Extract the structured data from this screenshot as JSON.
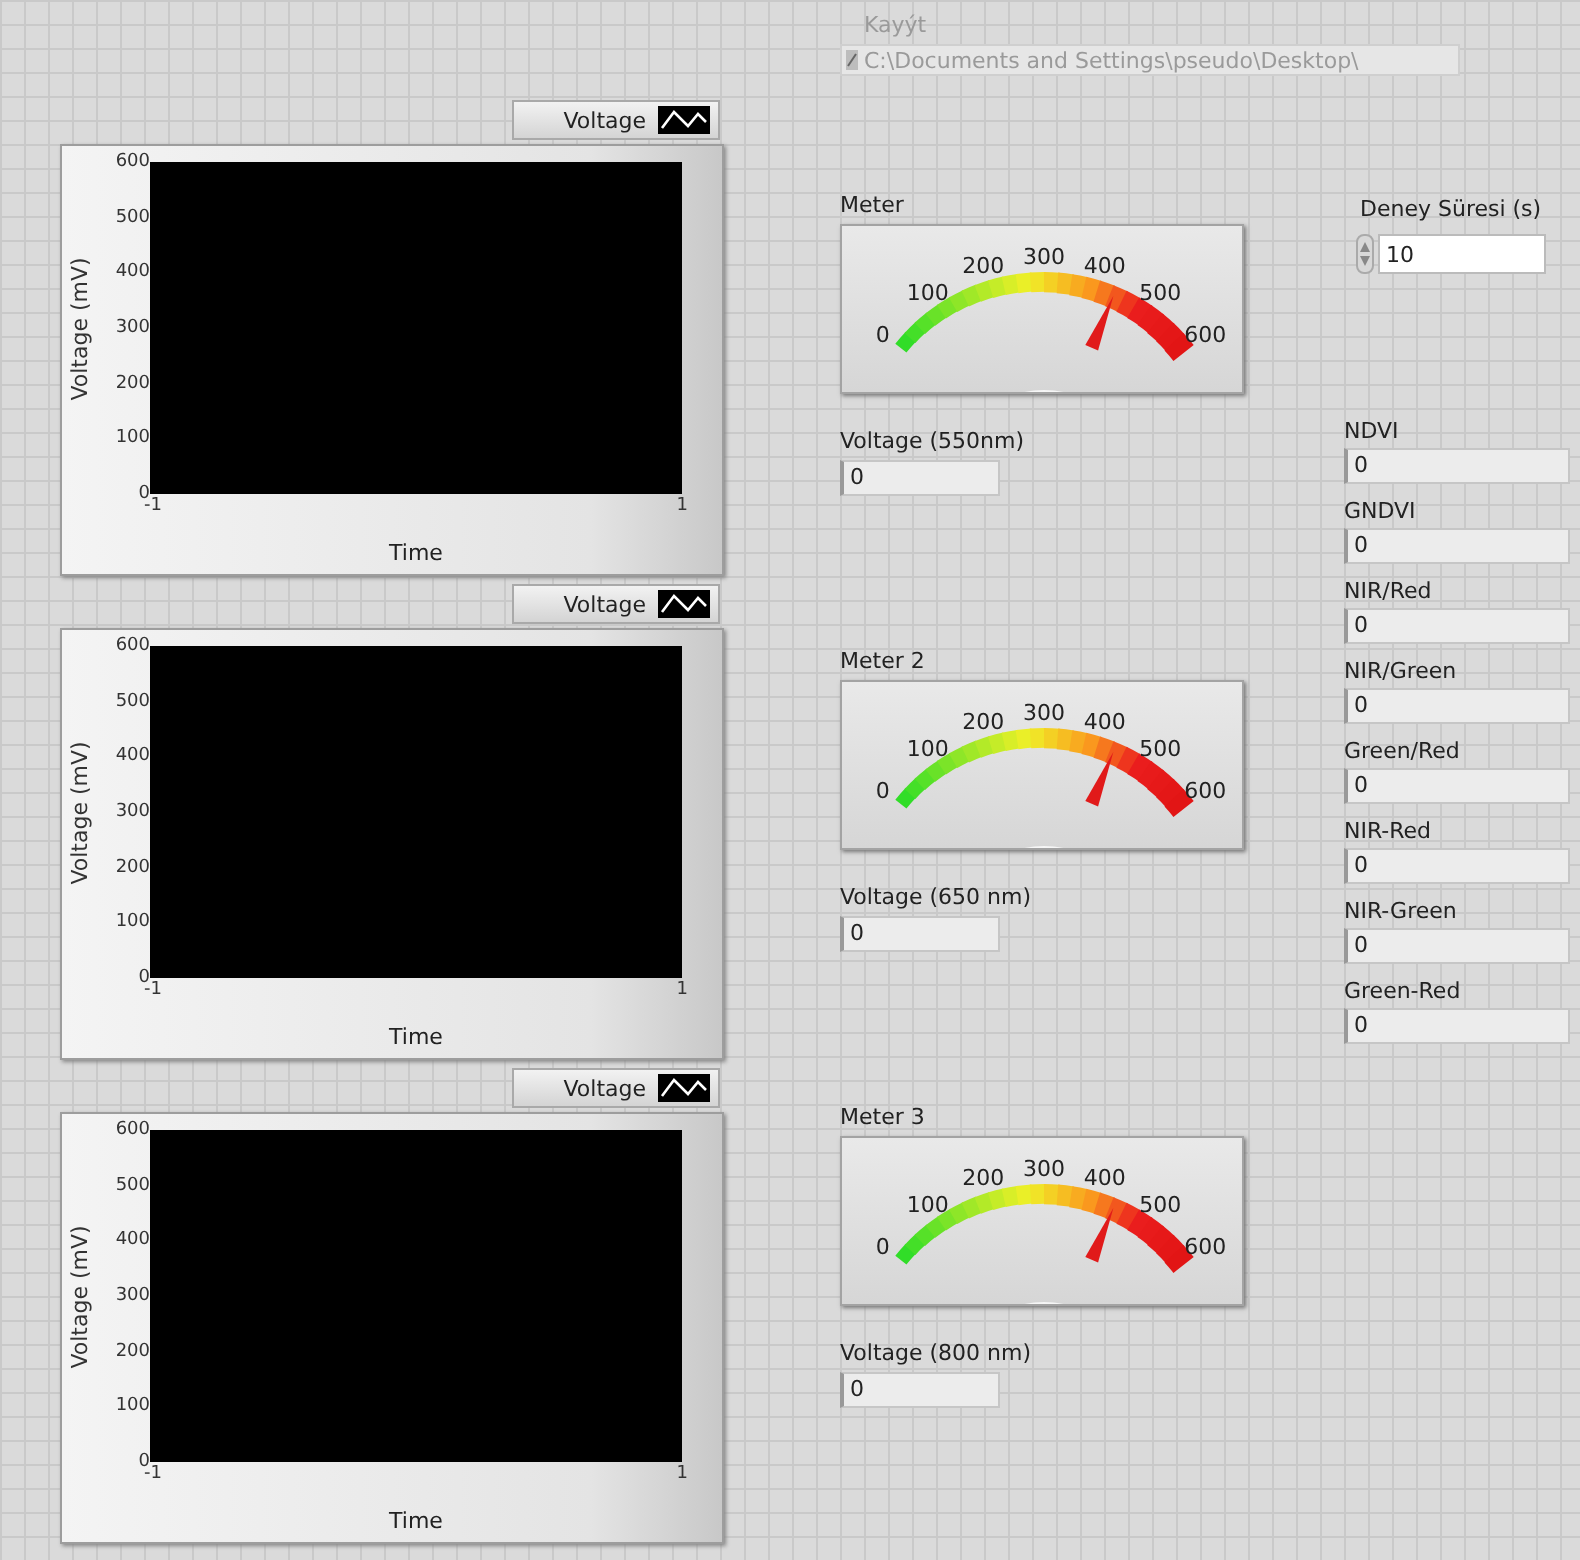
{
  "graphs": [
    {
      "legend": "Voltage",
      "ylabel": "Voltage (mV)",
      "xlabel": "Time",
      "yticks": [
        "600",
        "500",
        "400",
        "300",
        "200",
        "100",
        "0"
      ],
      "xticks": [
        "-1",
        "1"
      ]
    },
    {
      "legend": "Voltage",
      "ylabel": "Voltage (mV)",
      "xlabel": "Time",
      "yticks": [
        "600",
        "500",
        "400",
        "300",
        "200",
        "100",
        "0"
      ],
      "xticks": [
        "-1",
        "1"
      ]
    },
    {
      "legend": "Voltage",
      "ylabel": "Voltage (mV)",
      "xlabel": "Time",
      "yticks": [
        "600",
        "500",
        "400",
        "300",
        "200",
        "100",
        "0"
      ],
      "xticks": [
        "-1",
        "1"
      ]
    }
  ],
  "path_control": {
    "label": "Kayýt",
    "value": "C:\\Documents and Settings\\pseudo\\Desktop\\",
    "disabled": true
  },
  "meters": [
    {
      "label": "Meter",
      "scale": [
        "0",
        "100",
        "200",
        "300",
        "400",
        "500",
        "600"
      ],
      "readout_label": "Voltage (550nm)",
      "readout": "0"
    },
    {
      "label": "Meter 2",
      "scale": [
        "0",
        "100",
        "200",
        "300",
        "400",
        "500",
        "600"
      ],
      "readout_label": "Voltage (650 nm)",
      "readout": "0"
    },
    {
      "label": "Meter 3",
      "scale": [
        "0",
        "100",
        "200",
        "300",
        "400",
        "500",
        "600"
      ],
      "readout_label": "Voltage (800 nm)",
      "readout": "0"
    }
  ],
  "duration": {
    "label": "Deney Süresi (s)",
    "value": "10"
  },
  "indices": [
    {
      "label": "NDVI",
      "value": "0"
    },
    {
      "label": "GNDVI",
      "value": "0"
    },
    {
      "label": "NIR/Red",
      "value": "0"
    },
    {
      "label": "NIR/Green",
      "value": "0"
    },
    {
      "label": "Green/Red",
      "value": "0"
    },
    {
      "label": "NIR-Red",
      "value": "0"
    },
    {
      "label": "NIR-Green",
      "value": "0"
    },
    {
      "label": "Green-Red",
      "value": "0"
    }
  ]
}
